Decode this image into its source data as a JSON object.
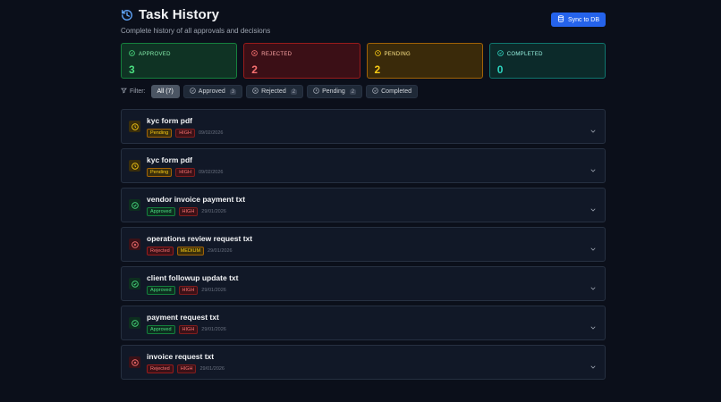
{
  "header": {
    "title": "Task History",
    "subtitle": "Complete history of all approvals and decisions",
    "sync_label": "Sync to DB"
  },
  "stats": [
    {
      "key": "approved",
      "label": "APPROVED",
      "value": "3"
    },
    {
      "key": "rejected",
      "label": "REJECTED",
      "value": "2"
    },
    {
      "key": "pending",
      "label": "PENDING",
      "value": "2"
    },
    {
      "key": "completed",
      "label": "COMPLETED",
      "value": "0"
    }
  ],
  "filters": {
    "label": "Filter:",
    "chips": [
      {
        "label": "All (7)",
        "count": ""
      },
      {
        "label": "Approved",
        "count": "3"
      },
      {
        "label": "Rejected",
        "count": "2"
      },
      {
        "label": "Pending",
        "count": "2"
      },
      {
        "label": "Completed",
        "count": ""
      }
    ]
  },
  "tasks": [
    {
      "title": "kyc form pdf",
      "status": "Pending",
      "priority": "HIGH",
      "date": "09/02/2026"
    },
    {
      "title": "kyc form pdf",
      "status": "Pending",
      "priority": "HIGH",
      "date": "09/02/2026"
    },
    {
      "title": "vendor invoice payment txt",
      "status": "Approved",
      "priority": "HIGH",
      "date": "29/01/2026"
    },
    {
      "title": "operations review request txt",
      "status": "Rejected",
      "priority": "MEDIUM",
      "date": "29/01/2026"
    },
    {
      "title": "client followup update txt",
      "status": "Approved",
      "priority": "HIGH",
      "date": "29/01/2026"
    },
    {
      "title": "payment request txt",
      "status": "Approved",
      "priority": "HIGH",
      "date": "29/01/2026"
    },
    {
      "title": "invoice request txt",
      "status": "Rejected",
      "priority": "HIGH",
      "date": "29/01/2026"
    }
  ],
  "colors": {
    "accent": "#2563eb",
    "approved": "#4ade80",
    "rejected": "#f87171",
    "pending": "#facc15",
    "completed": "#2dd4bf"
  }
}
